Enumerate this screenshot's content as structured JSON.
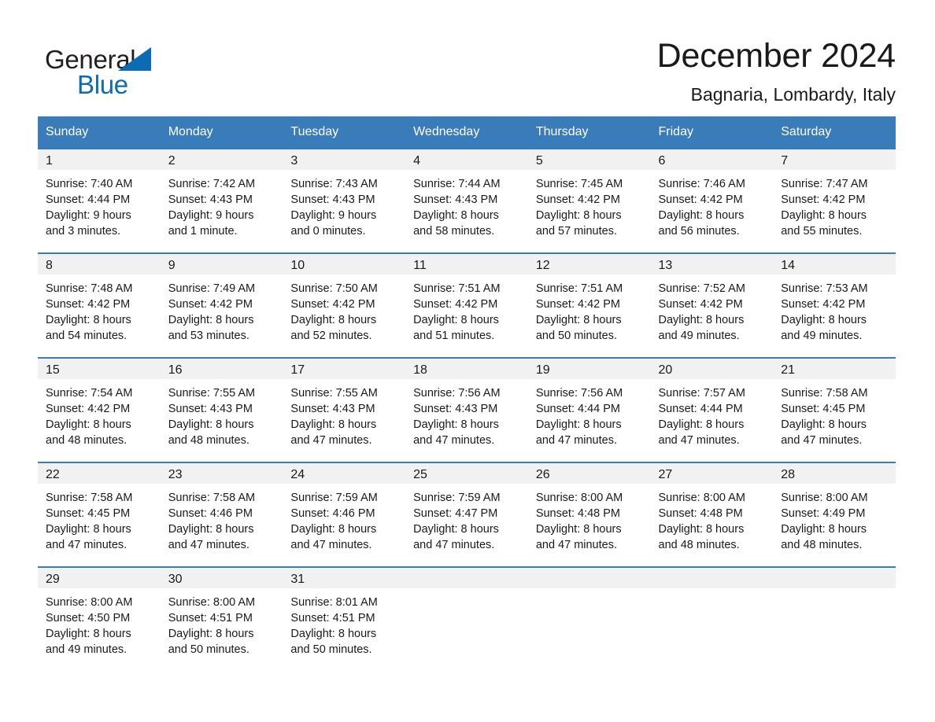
{
  "brand": {
    "word1": "General",
    "word2": "Blue",
    "triangle_color": "#0b6cb4",
    "icon": "triangle-logo-icon"
  },
  "header": {
    "title": "December 2024",
    "subtitle": "Bagnaria, Lombardy, Italy"
  },
  "theme": {
    "header_blue": "#3a7cba",
    "band_gray": "#f1f1f1",
    "text": "#1a1a1a"
  },
  "weekdays": [
    "Sunday",
    "Monday",
    "Tuesday",
    "Wednesday",
    "Thursday",
    "Friday",
    "Saturday"
  ],
  "weeks": [
    [
      {
        "day": "1",
        "sunrise": "Sunrise: 7:40 AM",
        "sunset": "Sunset: 4:44 PM",
        "daylight1": "Daylight: 9 hours",
        "daylight2": "and 3 minutes."
      },
      {
        "day": "2",
        "sunrise": "Sunrise: 7:42 AM",
        "sunset": "Sunset: 4:43 PM",
        "daylight1": "Daylight: 9 hours",
        "daylight2": "and 1 minute."
      },
      {
        "day": "3",
        "sunrise": "Sunrise: 7:43 AM",
        "sunset": "Sunset: 4:43 PM",
        "daylight1": "Daylight: 9 hours",
        "daylight2": "and 0 minutes."
      },
      {
        "day": "4",
        "sunrise": "Sunrise: 7:44 AM",
        "sunset": "Sunset: 4:43 PM",
        "daylight1": "Daylight: 8 hours",
        "daylight2": "and 58 minutes."
      },
      {
        "day": "5",
        "sunrise": "Sunrise: 7:45 AM",
        "sunset": "Sunset: 4:42 PM",
        "daylight1": "Daylight: 8 hours",
        "daylight2": "and 57 minutes."
      },
      {
        "day": "6",
        "sunrise": "Sunrise: 7:46 AM",
        "sunset": "Sunset: 4:42 PM",
        "daylight1": "Daylight: 8 hours",
        "daylight2": "and 56 minutes."
      },
      {
        "day": "7",
        "sunrise": "Sunrise: 7:47 AM",
        "sunset": "Sunset: 4:42 PM",
        "daylight1": "Daylight: 8 hours",
        "daylight2": "and 55 minutes."
      }
    ],
    [
      {
        "day": "8",
        "sunrise": "Sunrise: 7:48 AM",
        "sunset": "Sunset: 4:42 PM",
        "daylight1": "Daylight: 8 hours",
        "daylight2": "and 54 minutes."
      },
      {
        "day": "9",
        "sunrise": "Sunrise: 7:49 AM",
        "sunset": "Sunset: 4:42 PM",
        "daylight1": "Daylight: 8 hours",
        "daylight2": "and 53 minutes."
      },
      {
        "day": "10",
        "sunrise": "Sunrise: 7:50 AM",
        "sunset": "Sunset: 4:42 PM",
        "daylight1": "Daylight: 8 hours",
        "daylight2": "and 52 minutes."
      },
      {
        "day": "11",
        "sunrise": "Sunrise: 7:51 AM",
        "sunset": "Sunset: 4:42 PM",
        "daylight1": "Daylight: 8 hours",
        "daylight2": "and 51 minutes."
      },
      {
        "day": "12",
        "sunrise": "Sunrise: 7:51 AM",
        "sunset": "Sunset: 4:42 PM",
        "daylight1": "Daylight: 8 hours",
        "daylight2": "and 50 minutes."
      },
      {
        "day": "13",
        "sunrise": "Sunrise: 7:52 AM",
        "sunset": "Sunset: 4:42 PM",
        "daylight1": "Daylight: 8 hours",
        "daylight2": "and 49 minutes."
      },
      {
        "day": "14",
        "sunrise": "Sunrise: 7:53 AM",
        "sunset": "Sunset: 4:42 PM",
        "daylight1": "Daylight: 8 hours",
        "daylight2": "and 49 minutes."
      }
    ],
    [
      {
        "day": "15",
        "sunrise": "Sunrise: 7:54 AM",
        "sunset": "Sunset: 4:42 PM",
        "daylight1": "Daylight: 8 hours",
        "daylight2": "and 48 minutes."
      },
      {
        "day": "16",
        "sunrise": "Sunrise: 7:55 AM",
        "sunset": "Sunset: 4:43 PM",
        "daylight1": "Daylight: 8 hours",
        "daylight2": "and 48 minutes."
      },
      {
        "day": "17",
        "sunrise": "Sunrise: 7:55 AM",
        "sunset": "Sunset: 4:43 PM",
        "daylight1": "Daylight: 8 hours",
        "daylight2": "and 47 minutes."
      },
      {
        "day": "18",
        "sunrise": "Sunrise: 7:56 AM",
        "sunset": "Sunset: 4:43 PM",
        "daylight1": "Daylight: 8 hours",
        "daylight2": "and 47 minutes."
      },
      {
        "day": "19",
        "sunrise": "Sunrise: 7:56 AM",
        "sunset": "Sunset: 4:44 PM",
        "daylight1": "Daylight: 8 hours",
        "daylight2": "and 47 minutes."
      },
      {
        "day": "20",
        "sunrise": "Sunrise: 7:57 AM",
        "sunset": "Sunset: 4:44 PM",
        "daylight1": "Daylight: 8 hours",
        "daylight2": "and 47 minutes."
      },
      {
        "day": "21",
        "sunrise": "Sunrise: 7:58 AM",
        "sunset": "Sunset: 4:45 PM",
        "daylight1": "Daylight: 8 hours",
        "daylight2": "and 47 minutes."
      }
    ],
    [
      {
        "day": "22",
        "sunrise": "Sunrise: 7:58 AM",
        "sunset": "Sunset: 4:45 PM",
        "daylight1": "Daylight: 8 hours",
        "daylight2": "and 47 minutes."
      },
      {
        "day": "23",
        "sunrise": "Sunrise: 7:58 AM",
        "sunset": "Sunset: 4:46 PM",
        "daylight1": "Daylight: 8 hours",
        "daylight2": "and 47 minutes."
      },
      {
        "day": "24",
        "sunrise": "Sunrise: 7:59 AM",
        "sunset": "Sunset: 4:46 PM",
        "daylight1": "Daylight: 8 hours",
        "daylight2": "and 47 minutes."
      },
      {
        "day": "25",
        "sunrise": "Sunrise: 7:59 AM",
        "sunset": "Sunset: 4:47 PM",
        "daylight1": "Daylight: 8 hours",
        "daylight2": "and 47 minutes."
      },
      {
        "day": "26",
        "sunrise": "Sunrise: 8:00 AM",
        "sunset": "Sunset: 4:48 PM",
        "daylight1": "Daylight: 8 hours",
        "daylight2": "and 47 minutes."
      },
      {
        "day": "27",
        "sunrise": "Sunrise: 8:00 AM",
        "sunset": "Sunset: 4:48 PM",
        "daylight1": "Daylight: 8 hours",
        "daylight2": "and 48 minutes."
      },
      {
        "day": "28",
        "sunrise": "Sunrise: 8:00 AM",
        "sunset": "Sunset: 4:49 PM",
        "daylight1": "Daylight: 8 hours",
        "daylight2": "and 48 minutes."
      }
    ],
    [
      {
        "day": "29",
        "sunrise": "Sunrise: 8:00 AM",
        "sunset": "Sunset: 4:50 PM",
        "daylight1": "Daylight: 8 hours",
        "daylight2": "and 49 minutes."
      },
      {
        "day": "30",
        "sunrise": "Sunrise: 8:00 AM",
        "sunset": "Sunset: 4:51 PM",
        "daylight1": "Daylight: 8 hours",
        "daylight2": "and 50 minutes."
      },
      {
        "day": "31",
        "sunrise": "Sunrise: 8:01 AM",
        "sunset": "Sunset: 4:51 PM",
        "daylight1": "Daylight: 8 hours",
        "daylight2": "and 50 minutes."
      },
      {
        "day": "",
        "sunrise": "",
        "sunset": "",
        "daylight1": "",
        "daylight2": ""
      },
      {
        "day": "",
        "sunrise": "",
        "sunset": "",
        "daylight1": "",
        "daylight2": ""
      },
      {
        "day": "",
        "sunrise": "",
        "sunset": "",
        "daylight1": "",
        "daylight2": ""
      },
      {
        "day": "",
        "sunrise": "",
        "sunset": "",
        "daylight1": "",
        "daylight2": ""
      }
    ]
  ]
}
